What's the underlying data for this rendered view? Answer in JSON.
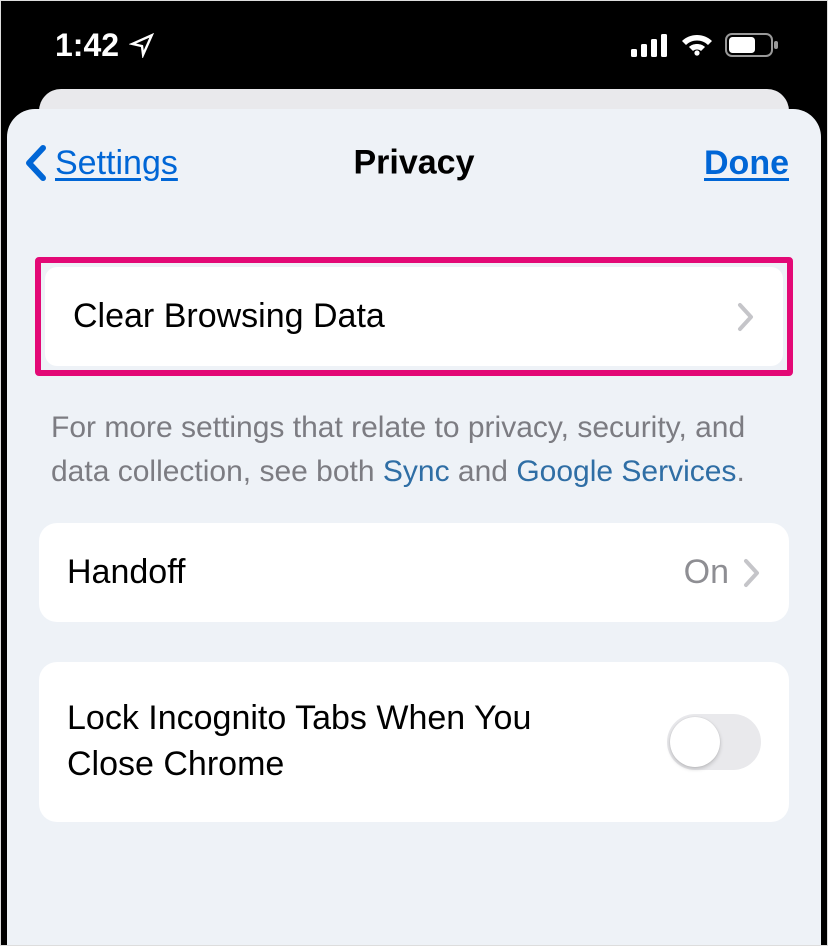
{
  "status": {
    "time": "1:42",
    "location_icon": "location-icon",
    "signal_icon": "signal-icon",
    "wifi_icon": "wifi-icon",
    "battery_icon": "battery-icon"
  },
  "nav": {
    "back_label": "Settings",
    "title": "Privacy",
    "done_label": "Done"
  },
  "rows": {
    "clear_browsing": {
      "label": "Clear Browsing Data"
    },
    "handoff": {
      "label": "Handoff",
      "value": "On"
    },
    "lock_incognito": {
      "label": "Lock Incognito Tabs When You Close Chrome",
      "enabled": false
    }
  },
  "footer": {
    "prefix": "For more settings that relate to privacy, security, and data collection, see both ",
    "link1": "Sync",
    "mid": " and ",
    "link2": "Google Services",
    "suffix": "."
  },
  "highlight": {
    "color": "#e30976",
    "target": "clear-browsing-data-cell"
  }
}
